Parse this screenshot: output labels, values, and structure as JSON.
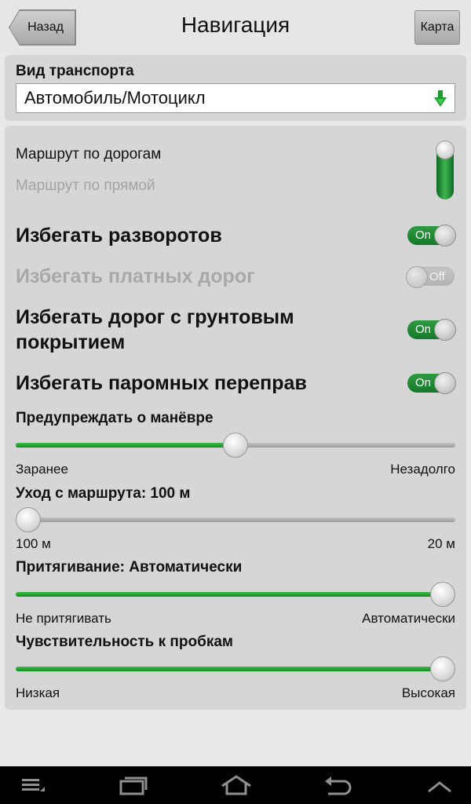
{
  "header": {
    "back_label": "Назад",
    "title": "Навигация",
    "map_label": "Карта"
  },
  "transport": {
    "label": "Вид транспорта",
    "selected": "Автомобиль/Мотоцикл"
  },
  "route_type": {
    "on_roads": "Маршрут по дорогам",
    "straight": "Маршрут по прямой",
    "selected": "on_roads"
  },
  "avoid": [
    {
      "label": "Избегать разворотов",
      "state": "On",
      "enabled": true
    },
    {
      "label": "Избегать платных дорог",
      "state": "Off",
      "enabled": false
    },
    {
      "label": "Избегать дорог с грунтовым покрытием",
      "state": "On",
      "enabled": true
    },
    {
      "label": "Избегать паромных переправ",
      "state": "On",
      "enabled": true
    }
  ],
  "sliders": [
    {
      "title": "Предупреждать о манёвре",
      "min_label": "Заранее",
      "max_label": "Незадолго",
      "value": 0.5
    },
    {
      "title": "Уход с маршрута: 100 м",
      "min_label": "100 м",
      "max_label": "20 м",
      "value": 0.0
    },
    {
      "title": "Притягивание: Автоматически",
      "min_label": "Не притягивать",
      "max_label": "Автоматически",
      "value": 1.0
    },
    {
      "title": "Чувствительность к пробкам",
      "min_label": "Низкая",
      "max_label": "Высокая",
      "value": 1.0
    }
  ],
  "colors": {
    "accent_green": "#1f8f2e",
    "panel": "#d6d6d6",
    "background": "#e9e9e9"
  },
  "navbar": {
    "icons": [
      "menu-icon",
      "recent-apps-icon",
      "home-icon",
      "back-icon",
      "up-chevron-icon"
    ]
  }
}
